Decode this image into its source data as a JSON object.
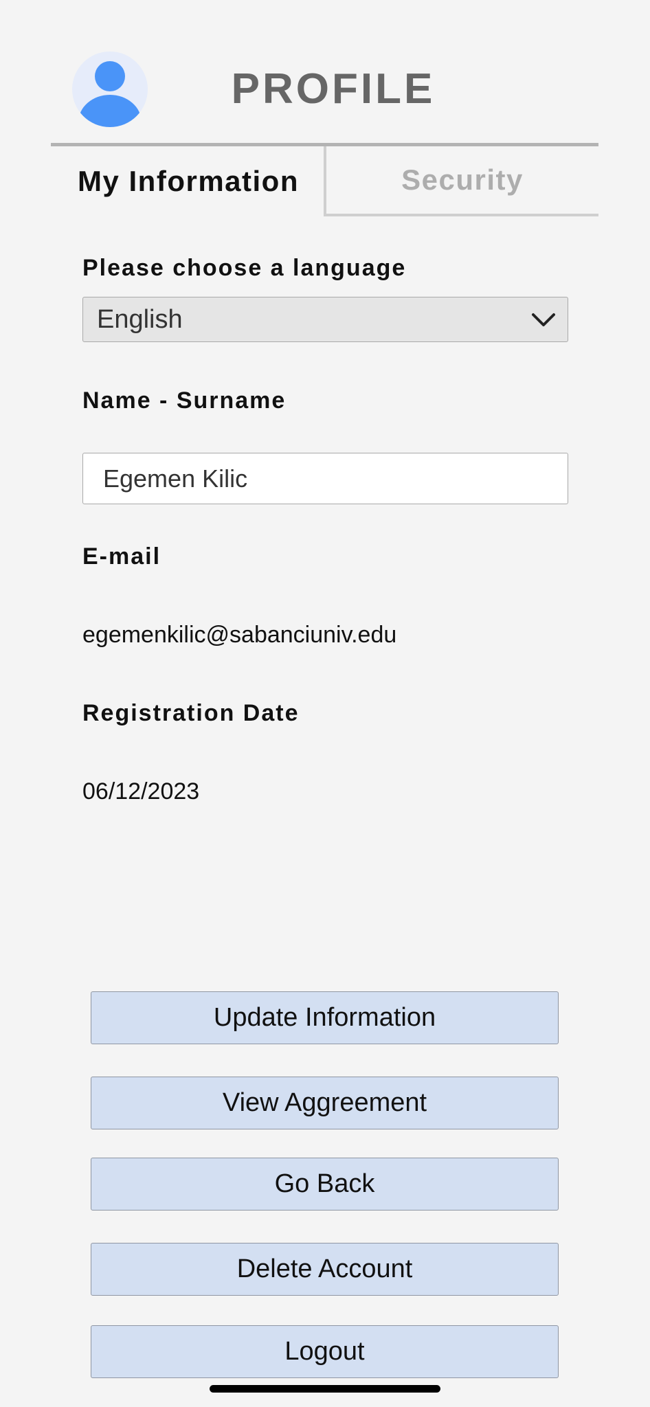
{
  "header": {
    "title": "PROFILE",
    "avatar_icon": "user-avatar-icon",
    "accent_color": "#4a94f8"
  },
  "tabs": [
    {
      "label": "My Information",
      "active": true
    },
    {
      "label": "Security",
      "active": false
    }
  ],
  "form": {
    "language": {
      "label": "Please choose a language",
      "selected": "English",
      "icon": "chevron-down-icon"
    },
    "name": {
      "label": "Name - Surname",
      "value": "Egemen Kilic"
    },
    "email": {
      "label": "E-mail",
      "value": "egemenkilic@sabanciuniv.edu"
    },
    "registration": {
      "label": "Registration Date",
      "value": "06/12/2023"
    }
  },
  "buttons": {
    "update": "Update Information",
    "agreement": "View Aggreement",
    "back": "Go Back",
    "delete": "Delete Account",
    "logout": "Logout"
  },
  "colors": {
    "background": "#f4f4f4",
    "button_fill": "#d3dff2",
    "inactive_tab": "#adadad"
  }
}
